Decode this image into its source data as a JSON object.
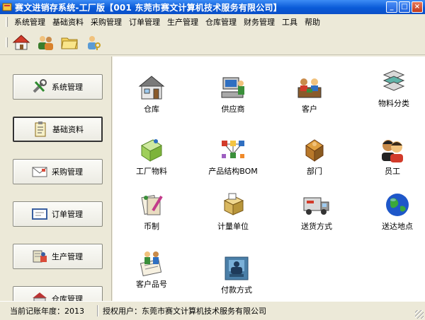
{
  "window": {
    "title": "赛文进销存系统-工厂版【001 东莞市赛文计算机技术服务有限公司】",
    "controls": [
      "_",
      "□",
      "×"
    ]
  },
  "menu": [
    "系统管理",
    "基础资料",
    "采购管理",
    "订单管理",
    "生产管理",
    "仓库管理",
    "财务管理",
    "工具",
    "帮助"
  ],
  "toolbar_icons": [
    "home-icon",
    "users-icon",
    "folder-icon",
    "user-key-icon"
  ],
  "sidebar": [
    {
      "label": "系统管理",
      "icon": "tools-icon",
      "active": false
    },
    {
      "label": "基础资料",
      "icon": "clipboard-icon",
      "active": true
    },
    {
      "label": "采购管理",
      "icon": "envelope-icon",
      "active": false
    },
    {
      "label": "订单管理",
      "icon": "certificate-icon",
      "active": false
    },
    {
      "label": "生产管理",
      "icon": "production-icon",
      "active": false
    },
    {
      "label": "仓库管理",
      "icon": "warehouse-icon",
      "active": false
    }
  ],
  "tiles": [
    {
      "label": "仓库",
      "icon": "warehouse-icon"
    },
    {
      "label": "供应商",
      "icon": "supplier-icon"
    },
    {
      "label": "客户",
      "icon": "customer-icon"
    },
    {
      "label": "物料分类",
      "icon": "material-category-icon"
    },
    {
      "label": "工厂物料",
      "icon": "factory-material-icon"
    },
    {
      "label": "产品结构BOM",
      "icon": "bom-structure-icon"
    },
    {
      "label": "部门",
      "icon": "department-icon"
    },
    {
      "label": "员工",
      "icon": "employee-icon"
    },
    {
      "label": "币制",
      "icon": "currency-icon"
    },
    {
      "label": "计量单位",
      "icon": "measure-unit-icon"
    },
    {
      "label": "送货方式",
      "icon": "delivery-truck-icon"
    },
    {
      "label": "送达地点",
      "icon": "globe-icon"
    },
    {
      "label": "客户品号",
      "icon": "customer-part-icon"
    },
    {
      "label": "付款方式",
      "icon": "payment-icon"
    }
  ],
  "status": {
    "year_label": "当前记账年度：",
    "year": "2013",
    "license_label": "授权用户：",
    "license_value": "东莞市赛文计算机技术服务有限公司"
  },
  "colors": {
    "titlebar": "#0a5bd8",
    "chrome": "#ece9d8",
    "content_bg": "#ffffff"
  }
}
